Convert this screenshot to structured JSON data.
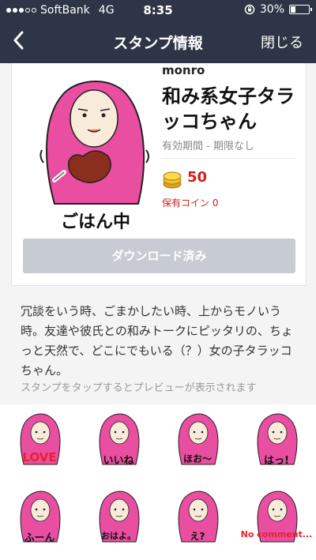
{
  "status_bar": {
    "carrier": "SoftBank",
    "network": "4G",
    "time": "8:35",
    "battery": "30%",
    "battery_level": 0.3
  },
  "nav": {
    "back_icon": "chevron-left-icon",
    "title": "スタンプ情報",
    "close_label": "閉じる"
  },
  "sticker": {
    "main_caption": "ごはん中",
    "author": "monro",
    "title": "和み系女子タラッコちゃん",
    "validity": "有効期間 - 期限なし",
    "price": "50",
    "owned_coins": "保有コイン 0",
    "download_label": "ダウンロード済み"
  },
  "description": "冗談をいう時、ごまかしたい時、上からモノいう時。友達や彼氏との和みトークにピッタリの、ちょっと天然で、どこにでもいる（？）女の子タラッコちゃん。",
  "preview_hint": "スタンプをタップするとプレビューが表示されます",
  "grid": [
    {
      "caption": "LOVE"
    },
    {
      "caption": "いいね"
    },
    {
      "caption": "ほお～"
    },
    {
      "caption": "はっ!"
    },
    {
      "caption": "ふーん"
    },
    {
      "caption": "おはよ。"
    },
    {
      "caption": "え?"
    },
    {
      "caption": "No comment..."
    }
  ],
  "colors": {
    "nav_bg": "#2e3546",
    "pink": "#e94ea1",
    "red": "#d21e1e",
    "disabled_button": "#c7ccd4"
  }
}
